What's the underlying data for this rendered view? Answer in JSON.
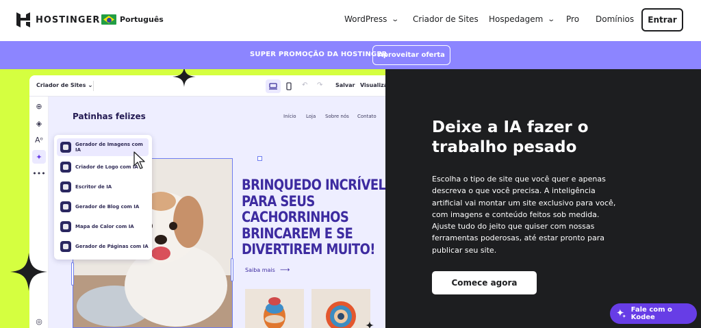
{
  "nav": {
    "logo_text": "HOSTINGER",
    "language": "Português",
    "items": [
      {
        "label": "WordPress",
        "dropdown": true
      },
      {
        "label": "Criador de Sites",
        "dropdown": false
      },
      {
        "label": "Hospedagem",
        "dropdown": true
      },
      {
        "label": "Pro",
        "dropdown": false
      },
      {
        "label": "Domínios",
        "dropdown": false
      }
    ],
    "login_label": "Entrar"
  },
  "promo": {
    "text": "SUPER PROMOÇÃO DA HOSTINGER",
    "button_label": "Aproveitar oferta"
  },
  "editor": {
    "site_selector": "Criador de Sites",
    "save_label": "Salvar",
    "preview_label": "Visualizar",
    "site_brand": "Patinhas felizes",
    "site_nav": [
      "Início",
      "Loja",
      "Sobre nós",
      "Contato"
    ],
    "headline": "BRINQUEDO INCRÍVEL PARA SEUS CACHORRINHOS BRINCAREM E SE DIVERTIREM MUITO!",
    "learn_more": "Saiba mais",
    "ai_tools": [
      "Gerador de Imagens com IA",
      "Criador de Logo com IA",
      "Escritor de IA",
      "Gerador de Blog com IA",
      "Mapa de Calor com IA",
      "Gerador de Páginas com IA"
    ]
  },
  "hero": {
    "title": "Deixe a IA fazer o trabalho pesado",
    "description": "Escolha o tipo de site que você quer e apenas descreva o que você precisa. A inteligência artificial vai montar um site exclusivo para você, com imagens e conteúdo feitos sob medida. Ajuste tudo do jeito que quiser com nossas ferramentas poderosas, até estar pronto para publicar seu site.",
    "cta_label": "Comece agora"
  },
  "chat": {
    "label": "Fale com o Kodee"
  },
  "colors": {
    "promo_bg": "#8c85ff",
    "lime": "#d5ff40",
    "dark": "#1d1e20",
    "accent": "#673de6"
  }
}
